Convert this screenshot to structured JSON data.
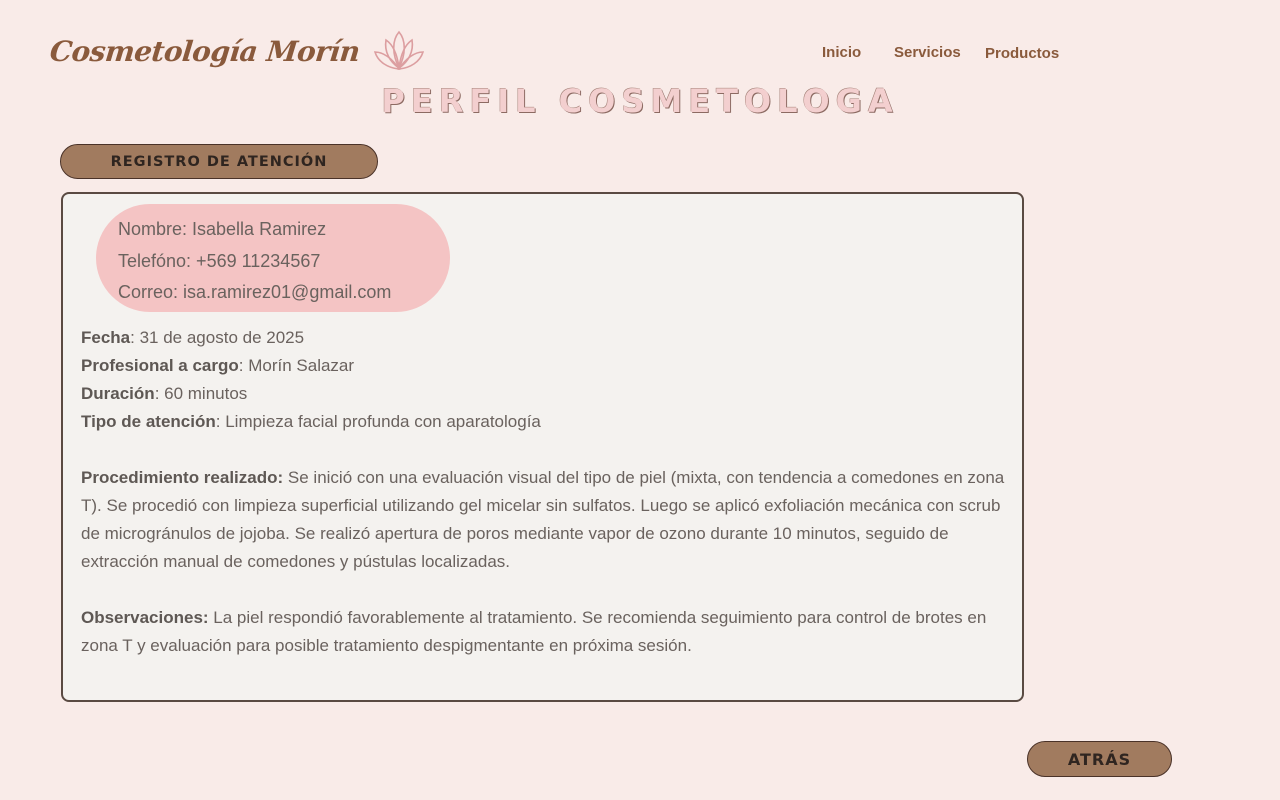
{
  "brand": {
    "name": "Cosmetología Morín",
    "icon": "lotus-icon"
  },
  "nav": {
    "items": [
      "Inicio",
      "Servicios",
      "Productos"
    ]
  },
  "page_title": "PERFIL COSMETOLOGA",
  "registro_button": "REGISTRO DE ATENCIÓN",
  "client": {
    "nombre": "Nombre: Isabella Ramirez",
    "telefono": "Telefóno: +569 11234567",
    "correo": "Correo: isa.ramirez01@gmail.com"
  },
  "record": {
    "fecha_label": "Fecha",
    "fecha_value": ": 31 de agosto de 2025",
    "profesional_label": "Profesional a cargo",
    "profesional_value": ": Morín Salazar",
    "duracion_label": "Duración",
    "duracion_value": ": 60 minutos",
    "tipo_label": "Tipo de atención",
    "tipo_value": ": Limpieza facial profunda con aparatología",
    "procedimiento_label": "Procedimiento realizado:",
    "procedimiento_value": " Se inició con una evaluación visual del tipo de piel (mixta, con tendencia a comedones en zona T). Se procedió con limpieza superficial utilizando gel micelar sin sulfatos. Luego se aplicó exfoliación mecánica con scrub de microgránulos de jojoba. Se realizó apertura de poros mediante vapor de ozono durante 10 minutos, seguido de extracción manual de comedones y pústulas localizadas.",
    "observaciones_label": "Observaciones:",
    "observaciones_value": " La piel respondió favorablemente al tratamiento. Se recomienda seguimiento para control de brotes en zona T y evaluación para posible tratamiento despigmentante en próxima sesión."
  },
  "back_button": "ATRÁS",
  "colors": {
    "background": "#f9ebe8",
    "brand": "#8a5a3c",
    "button": "#a17b5f",
    "client_pill": "#f4c4c4",
    "card": "#f4f2ef"
  }
}
